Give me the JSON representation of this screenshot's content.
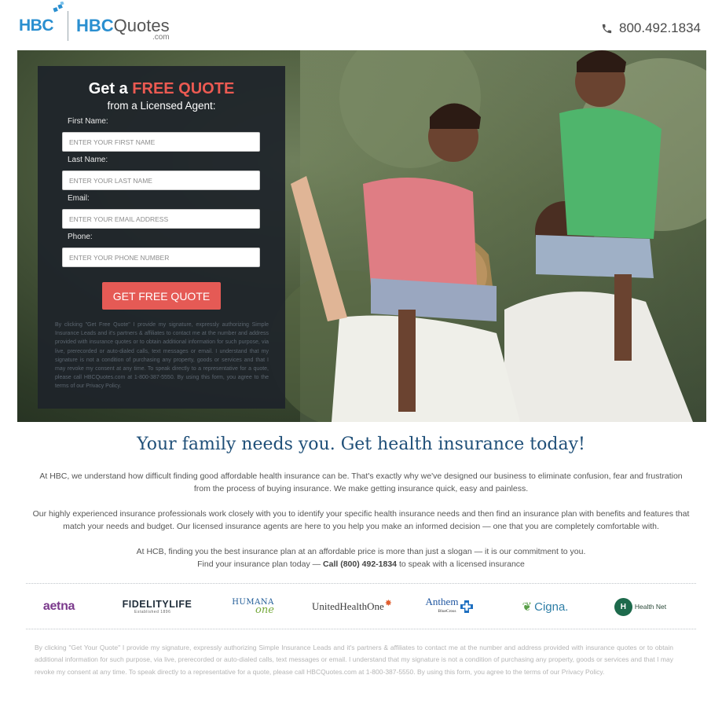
{
  "header": {
    "logo_main": "HBC",
    "logo_quotes_bold": "HBC",
    "logo_quotes_rest": "Quotes",
    "logo_com": ".com",
    "phone": "800.492.1834"
  },
  "form": {
    "title_prefix": "Get a",
    "title_highlight": "FREE QUOTE",
    "subtitle": "from a Licensed Agent:",
    "fields": [
      {
        "label": "First Name:",
        "placeholder": "ENTER YOUR FIRST NAME",
        "value": ""
      },
      {
        "label": "Last Name:",
        "placeholder": "ENTER YOUR LAST NAME",
        "value": ""
      },
      {
        "label": "Email:",
        "placeholder": "ENTER YOUR EMAIL ADDRESS",
        "value": ""
      },
      {
        "label": "Phone:",
        "placeholder": "ENTER YOUR PHONE NUMBER",
        "value": ""
      }
    ],
    "submit_label": "GET FREE QUOTE",
    "disclaimer": "By clicking \"Get Free Quote\" I provide my signature, expressly authorizing Simple Insurance Leads and it's partners & affiliates to contact me at the number and address provided with insurance quotes or to obtain additional information for such purpose, via live, prerecorded or auto-dialed calls, text messages or email. I understand that my signature is not a condition of purchasing any property, goods or services and that I may revoke my consent at any time. To speak directly to a representative for a quote, please call HBCQuotes.com at 1-800-387-5550. By using this form, you agree to the terms of our Privacy Policy."
  },
  "content": {
    "headline": "Your family needs you. Get health insurance today!",
    "para1": "At HBC, we understand how difficult finding good affordable health insurance can be. That's exactly why we've designed our business to eliminate confusion, fear and frustration from the process of buying insurance. We make getting insurance quick, easy and painless.",
    "para2": "Our highly experienced insurance professionals work closely with you to identify your specific health insurance needs and then find an insurance plan with benefits and features that match your needs and budget. Our licensed insurance agents are here to you help you make an informed decision — one that you are completely comfortable with.",
    "para3_line1": "At HCB, finding you the best insurance plan at an affordable price is more than just a slogan — it is our commitment to you.",
    "para3_line2_before": "Find your insurance plan today —",
    "para3_call": "Call (800) 492-1834",
    "para3_line2_after": "to speak with a licensed insurance"
  },
  "partners": {
    "aetna": "aetna",
    "fidelity": "FIDELITYLIFE",
    "fidelity_sub": "Established 1896",
    "humana": "HUMANA",
    "humana_one": "one",
    "uho": "UnitedHealthOne",
    "anthem": "Anthem",
    "anthem_sub": "BlueCross",
    "cigna": "Cigna.",
    "healthnet_mark": "H",
    "healthnet": "Health Net"
  },
  "bottom_disclaimer": "By clicking \"Get Your Quote\" I provide my signature, expressly authorizing Simple Insurance Leads and it's partners & affiliates to contact me at the number and address provided with insurance quotes or to obtain additional information for such purpose, via live, prerecorded or auto-dialed calls, text messages or email. I understand that my signature is not a condition of purchasing any property, goods or services and that I may revoke my consent at any time. To speak directly to a representative for a quote, please call HBCQuotes.com at 1-800-387-5550. By using this form, you agree to the terms of our Privacy Policy.",
  "colors": {
    "brand_blue": "#2a8fd0",
    "accent_red": "#e55a55",
    "headline_navy": "#1f4f78"
  }
}
